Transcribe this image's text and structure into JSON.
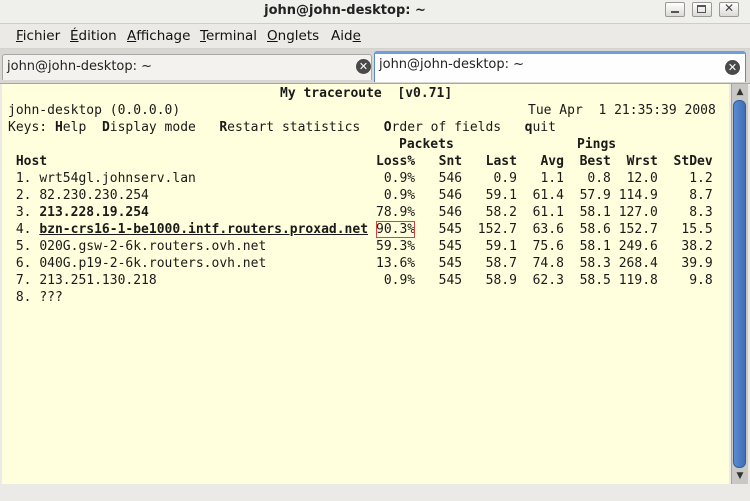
{
  "window": {
    "title": "john@john-desktop: ~"
  },
  "menu": [
    {
      "first": "F",
      "rest": "ichier"
    },
    {
      "first": "É",
      "rest": "dition"
    },
    {
      "first": "A",
      "rest": "ffichage"
    },
    {
      "first": "T",
      "rest": "erminal"
    },
    {
      "first": "O",
      "rest": "nglets"
    },
    {
      "first": "",
      "pre": "Aid",
      "ul": "e"
    }
  ],
  "tabs": [
    {
      "label": "john@john-desktop: ~",
      "active": false
    },
    {
      "label": "john@john-desktop: ~",
      "active": true
    }
  ],
  "mtr": {
    "title": "My traceroute  [v0.71]",
    "hostline": "john-desktop (0.0.0.0)",
    "datetime": "Tue Apr  1 21:35:39 2008",
    "keys_label": "Keys:",
    "keys": [
      {
        "k": "H",
        "rest": "elp"
      },
      {
        "k": "D",
        "rest": "isplay mode"
      },
      {
        "k": "R",
        "rest": "estart statistics"
      },
      {
        "k": "O",
        "rest": "rder of fields"
      },
      {
        "k": "q",
        "rest": "uit"
      }
    ],
    "group_headers": {
      "packets": "Packets",
      "pings": "Pings"
    },
    "columns": [
      "Host",
      "Loss%",
      "Snt",
      "Last",
      "Avg",
      "Best",
      "Wrst",
      "StDev"
    ],
    "rows": [
      {
        "num": "1.",
        "host": "wrt54gl.johnserv.lan",
        "loss": "0.9%",
        "snt": "546",
        "last": "0.9",
        "avg": "1.1",
        "best": "0.8",
        "wrst": "12.0",
        "stdev": "1.2",
        "style": "normal"
      },
      {
        "num": "2.",
        "host": "82.230.230.254",
        "loss": "0.9%",
        "snt": "546",
        "last": "59.1",
        "avg": "61.4",
        "best": "57.9",
        "wrst": "114.9",
        "stdev": "8.7",
        "style": "normal"
      },
      {
        "num": "3.",
        "host": "213.228.19.254",
        "loss": "78.9%",
        "snt": "546",
        "last": "58.2",
        "avg": "61.1",
        "best": "58.1",
        "wrst": "127.0",
        "stdev": "8.3",
        "style": "bold"
      },
      {
        "num": "4.",
        "host": "bzn-crs16-1-be1000.intf.routers.proxad.net",
        "loss": "90.3%",
        "snt": "545",
        "last": "152.7",
        "avg": "63.6",
        "best": "58.6",
        "wrst": "152.7",
        "stdev": "15.5",
        "style": "bold-underline"
      },
      {
        "num": "5.",
        "host": "020G.gsw-2-6k.routers.ovh.net",
        "loss": "59.3%",
        "snt": "545",
        "last": "59.1",
        "avg": "75.6",
        "best": "58.1",
        "wrst": "249.6",
        "stdev": "38.2",
        "style": "normal"
      },
      {
        "num": "6.",
        "host": "040G.p19-2-6k.routers.ovh.net",
        "loss": "13.6%",
        "snt": "545",
        "last": "58.7",
        "avg": "74.8",
        "best": "58.3",
        "wrst": "268.4",
        "stdev": "39.9",
        "style": "normal"
      },
      {
        "num": "7.",
        "host": "213.251.130.218",
        "loss": "0.9%",
        "snt": "545",
        "last": "58.9",
        "avg": "62.3",
        "best": "58.5",
        "wrst": "119.8",
        "stdev": "9.8",
        "style": "normal"
      },
      {
        "num": "8.",
        "host": "???",
        "loss": "",
        "snt": "",
        "last": "",
        "avg": "",
        "best": "",
        "wrst": "",
        "stdev": "",
        "style": "normal"
      }
    ]
  },
  "scrollbar": {
    "up": "▲",
    "down": "▼"
  },
  "icons": {
    "minimize": "minimize-icon",
    "maximize": "maximize-icon",
    "close": "close-icon",
    "tab_close": "tab-close-icon"
  },
  "colors": {
    "terminal_bg": "#ffffdd",
    "accent": "#5a88c8",
    "highlight_border": "#d94040"
  }
}
